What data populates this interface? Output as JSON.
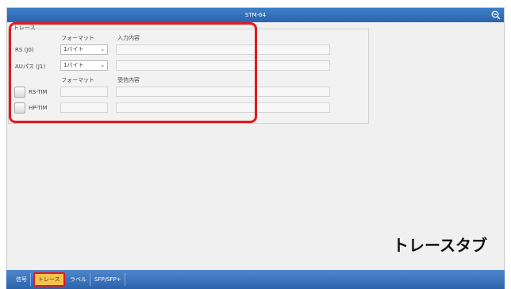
{
  "titlebar": {
    "title": "STM-64"
  },
  "panel": {
    "section_title": "トレース",
    "format_header_1": "フォーマット",
    "input_header": "入力内容",
    "rows_send": [
      {
        "label": "RS (J0)",
        "format_value": "1バイト"
      },
      {
        "label": "AUパス (J1)",
        "format_value": "1バイト"
      }
    ],
    "format_header_2": "フォーマット",
    "receive_header": "受信内容",
    "rows_receive": [
      {
        "label": "RS-TIM"
      },
      {
        "label": "HP-TIM"
      }
    ]
  },
  "annotation": {
    "label": "トレースタブ"
  },
  "tabs": [
    {
      "label": "信号"
    },
    {
      "label": "トレース"
    },
    {
      "label": "ラベル"
    },
    {
      "label": "SFP/SFP+"
    }
  ],
  "colors": {
    "highlight": "#e0191f",
    "titlebar": "#2a63ae",
    "active_tab": "#f7c24a"
  }
}
